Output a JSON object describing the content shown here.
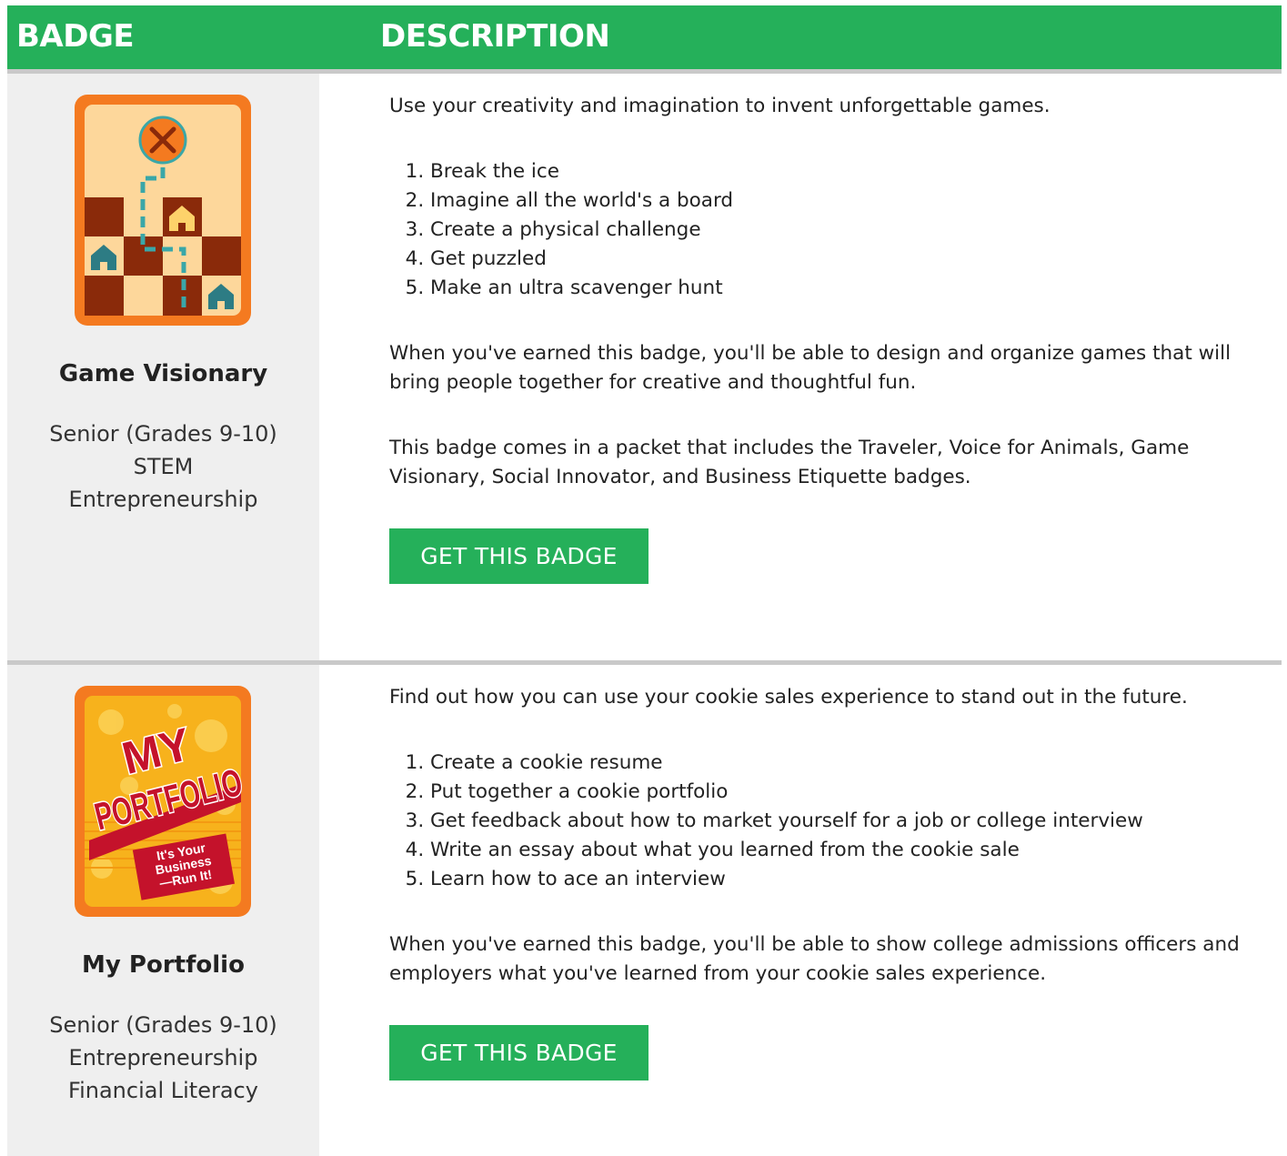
{
  "header": {
    "badge_col": "BADGE",
    "description_col": "DESCRIPTION"
  },
  "colors": {
    "green": "#25b05a",
    "gray": "#efefef",
    "divider": "#c9c9c9"
  },
  "badges": [
    {
      "name": "Game Visionary",
      "meta": [
        "Senior (Grades 9-10)",
        "STEM",
        "Entrepreneurship"
      ],
      "intro": "Use your creativity and imagination to invent unforgettable games.",
      "steps": [
        "Break the ice",
        "Imagine all the world's a board",
        "Create a physical challenge",
        "Get puzzled",
        "Make an ultra scavenger hunt"
      ],
      "outcome": "When you've earned this badge, you'll be able to design and organize games that will bring people together for creative and thoughtful fun.",
      "packet": "This badge comes in a packet that includes the Traveler, Voice for Animals, Game Visionary, Social Innovator, and Business Etiquette badges.",
      "button": "GET THIS BADGE",
      "icon": "game-visionary-badge-icon"
    },
    {
      "name": "My Portfolio",
      "meta": [
        "Senior (Grades 9-10)",
        "Entrepreneurship",
        "Financial Literacy"
      ],
      "intro": "Find out how you can use your cookie sales experience to stand out in the future.",
      "steps": [
        "Create a cookie resume",
        "Put together a cookie portfolio",
        "Get feedback about how to market yourself for a job or college interview",
        "Write an essay about what you learned from the cookie sale",
        "Learn how to ace an interview"
      ],
      "outcome": "When you've earned this badge, you'll be able to show college admissions officers and employers what you've learned from your cookie sales experience.",
      "button": "GET THIS BADGE",
      "icon": "my-portfolio-badge-icon",
      "logo": {
        "line1": "MY",
        "line2": "PORTFOLIO",
        "ribbon": [
          "It's Your",
          "Business",
          "—Run It!"
        ]
      }
    }
  ]
}
